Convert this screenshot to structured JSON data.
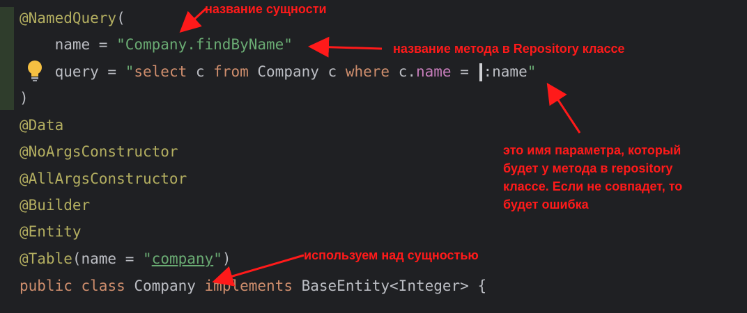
{
  "code_lines": [
    [
      {
        "t": "@NamedQuery",
        "c": "ann"
      },
      {
        "t": "(",
        "c": "plain"
      }
    ],
    [
      {
        "t": "    name = ",
        "c": "plain"
      },
      {
        "t": "\"Company.findByName\"",
        "c": "str"
      }
    ],
    [
      {
        "t": "    query = ",
        "c": "plain"
      },
      {
        "t": "\"",
        "c": "str"
      },
      {
        "t": "select",
        "c": "kw"
      },
      {
        "t": " c ",
        "c": "plain"
      },
      {
        "t": "from",
        "c": "kw"
      },
      {
        "t": " Company c ",
        "c": "plain"
      },
      {
        "t": "where",
        "c": "kw"
      },
      {
        "t": " c.",
        "c": "plain"
      },
      {
        "t": "name",
        "c": "field"
      },
      {
        "t": " = ",
        "c": "plain"
      },
      {
        "t": "",
        "c": "caret"
      },
      {
        "t": ":name",
        "c": "plain"
      },
      {
        "t": "\"",
        "c": "str"
      }
    ],
    [
      {
        "t": ")",
        "c": "plain"
      }
    ],
    [
      {
        "t": "@Data",
        "c": "ann"
      }
    ],
    [
      {
        "t": "@NoArgsConstructor",
        "c": "ann"
      }
    ],
    [
      {
        "t": "@AllArgsConstructor",
        "c": "ann"
      }
    ],
    [
      {
        "t": "@Builder",
        "c": "ann"
      }
    ],
    [
      {
        "t": "@Entity",
        "c": "ann"
      }
    ],
    [
      {
        "t": "@Table",
        "c": "ann"
      },
      {
        "t": "(name = ",
        "c": "plain"
      },
      {
        "t": "\"",
        "c": "str"
      },
      {
        "t": "company",
        "c": "link"
      },
      {
        "t": "\"",
        "c": "str"
      },
      {
        "t": ")",
        "c": "plain"
      }
    ],
    [
      {
        "t": "public",
        "c": "kw"
      },
      {
        "t": " ",
        "c": "plain"
      },
      {
        "t": "class",
        "c": "kw"
      },
      {
        "t": " Company ",
        "c": "plain"
      },
      {
        "t": "implements",
        "c": "kw"
      },
      {
        "t": " BaseEntity<Integer> {",
        "c": "plain"
      }
    ]
  ],
  "annotations": {
    "entity_name": "название сущности",
    "method_name": "название метода в Repository классе",
    "param_name_lines": [
      "это имя параметра, который",
      "будет у метода в repository",
      "классе. Если не совпадет, то",
      "будет ошибка"
    ],
    "usage": "используем над сущностью"
  },
  "colors": {
    "background": "#1f2023",
    "annotation": "#b3ae60",
    "keyword": "#cf8e6d",
    "string": "#6aab73",
    "field": "#c77dbb",
    "text": "#bcbec4",
    "note_red": "#ff1a1a"
  },
  "icons": {
    "intention_bulb": "lightbulb-icon"
  }
}
